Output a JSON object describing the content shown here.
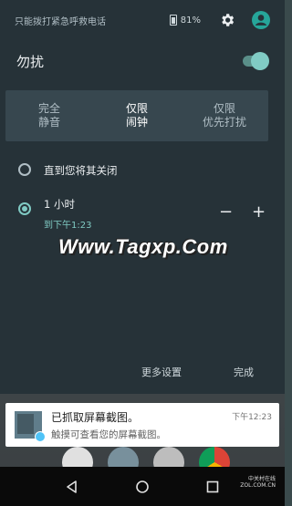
{
  "status": {
    "carrier": "只能拨打紧急呼救电话",
    "battery": "81%"
  },
  "dnd": {
    "title": "勿扰",
    "enabled": true
  },
  "modes": [
    {
      "line1": "完全",
      "line2": "静音",
      "selected": false
    },
    {
      "line1": "仅限",
      "line2": "闹钟",
      "selected": true
    },
    {
      "line1": "仅限",
      "line2": "优先打扰",
      "selected": false
    }
  ],
  "options": {
    "until_off": "直到您将其关闭",
    "duration_label": "1 小时",
    "duration_sub": "到下午1:23"
  },
  "stepper": {
    "minus": "−",
    "plus": "+"
  },
  "watermark": "Www.Tagxp.Com",
  "footer": {
    "more_settings": "更多设置",
    "done": "完成"
  },
  "notification": {
    "title": "已抓取屏幕截图。",
    "body": "触摸可查看您的屏幕截图。",
    "time": "下午12:23"
  },
  "corner_logo": {
    "line1": "中关村在线",
    "line2": "ZOL.COM.CN"
  },
  "colors": {
    "accent": "#80cbc4",
    "shade": "#263238",
    "modes_bg": "#37474f"
  }
}
